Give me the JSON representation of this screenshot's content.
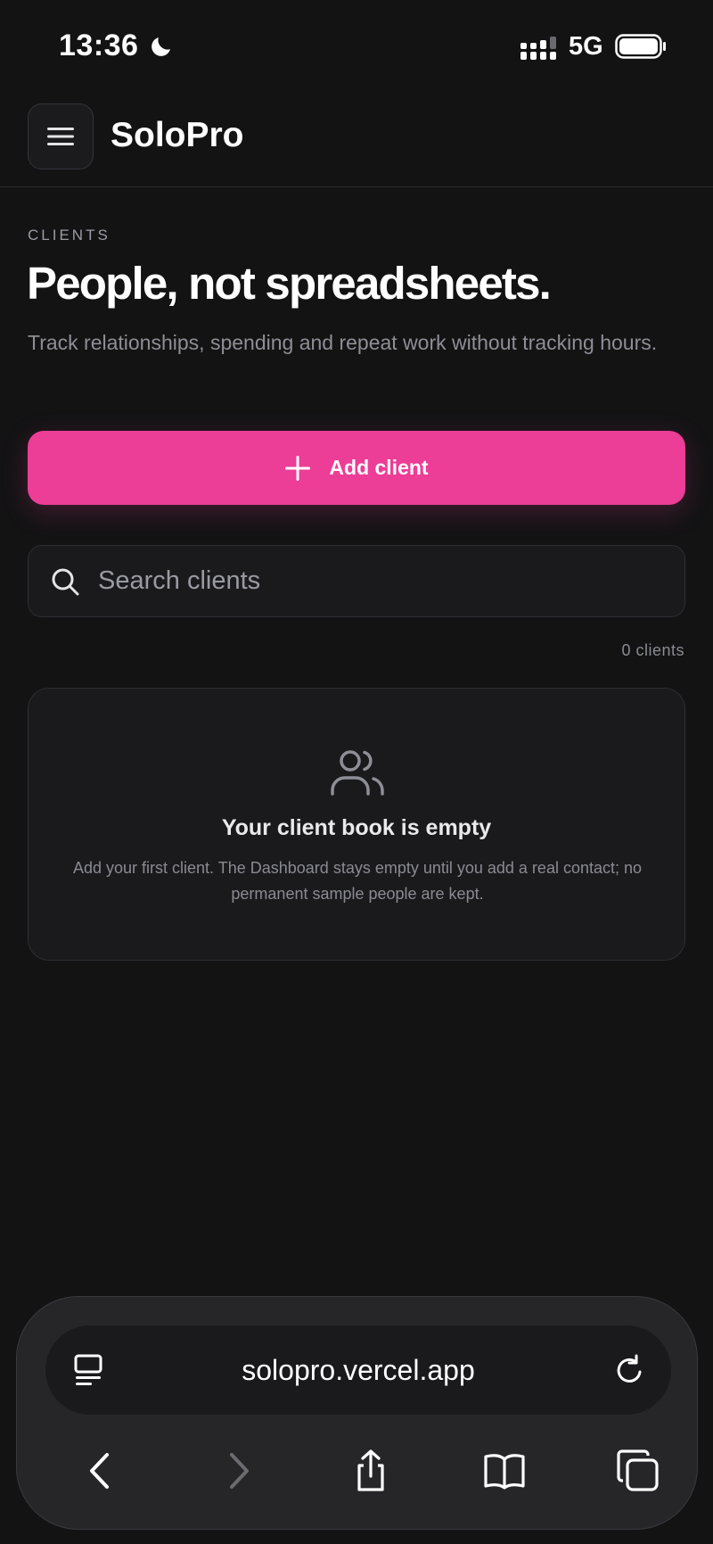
{
  "status_bar": {
    "time": "13:36",
    "network": "5G",
    "icons": [
      "moon-icon",
      "signal-icon",
      "battery-icon"
    ]
  },
  "header": {
    "brand": "SoloPro",
    "menu_icon": "hamburger-icon"
  },
  "page": {
    "eyebrow": "CLIENTS",
    "title": "People, not spreadsheets.",
    "subtitle": "Track relationships, spending and repeat work without tracking hours."
  },
  "add_button": {
    "label": "Add client",
    "icon": "plus-icon"
  },
  "search": {
    "placeholder": "Search clients",
    "value": "",
    "icon": "search-icon"
  },
  "count_label": "0 clients",
  "empty_state": {
    "icon": "users-icon",
    "title": "Your client book is empty",
    "description": "Add your first client. The Dashboard stays empty until you add a real contact; no permanent sample people are kept."
  },
  "browser": {
    "url": "solopro.vercel.app",
    "toolbar_icons": [
      "back-icon",
      "forward-icon",
      "share-icon",
      "bookmarks-icon",
      "tabs-icon"
    ]
  },
  "colors": {
    "background": "#131314",
    "accent": "#ec3d97",
    "card": "#1a1a1d",
    "muted_text": "#8e8e96"
  }
}
